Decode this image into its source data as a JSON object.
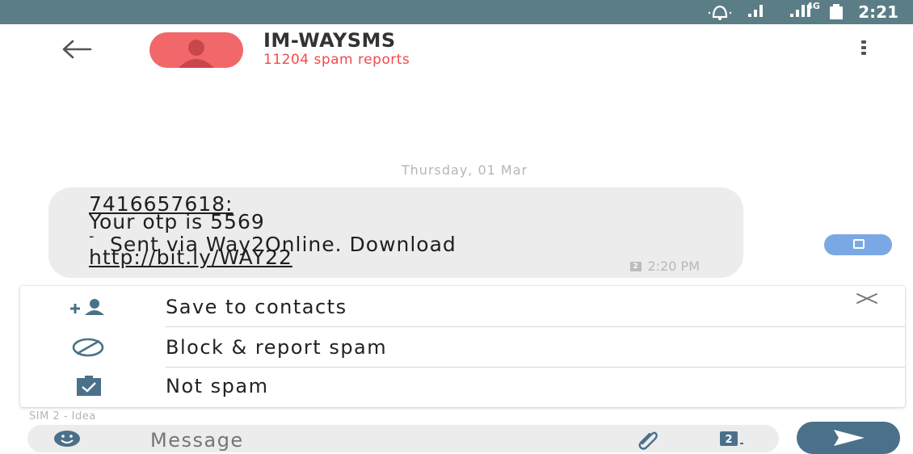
{
  "status_bar": {
    "network_label": "4G",
    "time": "2:21",
    "icons": [
      "alarm-icon",
      "signal-icon",
      "battery-icon"
    ],
    "background": "#5b7d86"
  },
  "header": {
    "back_icon": "back-arrow-icon",
    "title": "IM-WAYSMS",
    "subtitle": "11204 spam reports",
    "subtitle_color": "#f24a4a",
    "avatar_color": "#f2686a",
    "menu_icon": "kebab-menu-icon"
  },
  "conversation": {
    "date_separator": "Thursday, 01 Mar",
    "message": {
      "lines": [
        "7416657618:",
        "Your otp is 5569",
        "-",
        "Sent via Way2Online. Download",
        "http://bit.ly/WAY22"
      ],
      "sim_badge": "2",
      "time": "2:20 PM"
    }
  },
  "spam_card": {
    "items": [
      {
        "label": "Save to contacts",
        "icon": "add-contact-icon"
      },
      {
        "label": "Block & report spam",
        "icon": "block-icon"
      },
      {
        "label": "Not spam",
        "icon": "not-spam-clipboard-icon"
      }
    ],
    "close_icon": "close-icon"
  },
  "composer": {
    "sim_label": "SIM 2 - Idea",
    "placeholder": "Message",
    "emoji_icon": "emoji-icon",
    "attach_icon": "paperclip-icon",
    "sim_select_icon": "sim-select-icon",
    "sim_select_badge": "2",
    "send_icon": "send-icon"
  }
}
